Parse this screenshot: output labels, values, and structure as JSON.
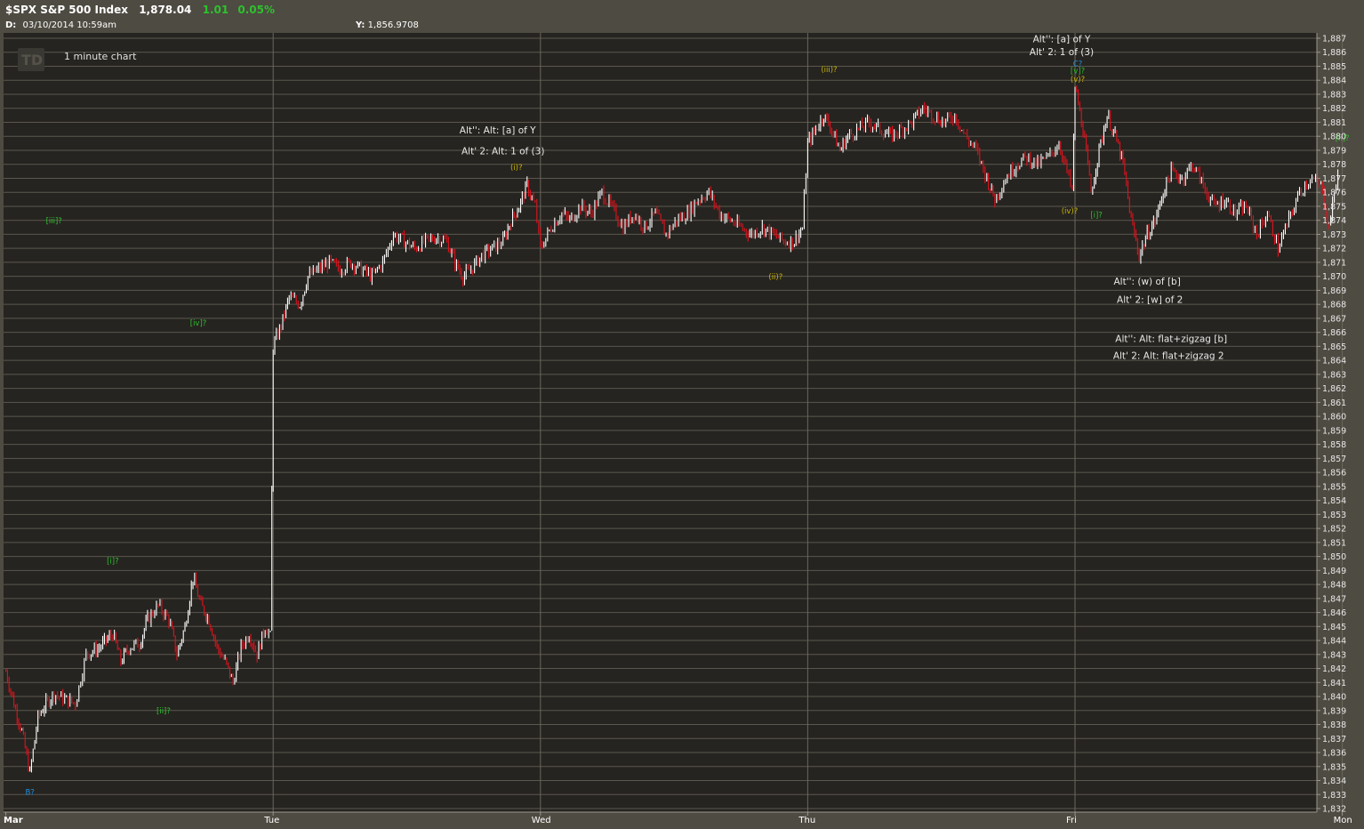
{
  "header": {
    "symbol": "$SPX S&P 500 Index",
    "last": "1,878.04",
    "change": "1.01",
    "change_pct": "0.05%",
    "date_label": "D:",
    "date_value": "03/10/2014  10:59am",
    "y_label": "Y:",
    "y_value": "1,856.9708"
  },
  "watermark": {
    "logo": "TD",
    "chart_label": "1 minute chart"
  },
  "colors": {
    "background": "#4e4b42",
    "plot_bg": "#262420",
    "grid": "#5a574e",
    "up_bar": "#ffffff",
    "down_bar": "#e0121d",
    "green_label": "#2ec12e",
    "yellow_label": "#c8b400",
    "blue_label": "#1f8fe0",
    "text": "#e8e8e8"
  },
  "chart_data": {
    "type": "line",
    "title": "$SPX S&P 500 Index",
    "ylim": [
      1832,
      1887
    ],
    "y_ticks": [
      "1,832",
      "1,833",
      "1,834",
      "1,835",
      "1,836",
      "1,837",
      "1,838",
      "1,839",
      "1,840",
      "1,841",
      "1,842",
      "1,843",
      "1,844",
      "1,845",
      "1,846",
      "1,847",
      "1,848",
      "1,849",
      "1,850",
      "1,851",
      "1,852",
      "1,853",
      "1,854",
      "1,855",
      "1,856",
      "1,857",
      "1,858",
      "1,859",
      "1,860",
      "1,861",
      "1,862",
      "1,863",
      "1,864",
      "1,865",
      "1,866",
      "1,867",
      "1,868",
      "1,869",
      "1,870",
      "1,871",
      "1,872",
      "1,873",
      "1,874",
      "1,875",
      "1,876",
      "1,877",
      "1,878",
      "1,879",
      "1,880",
      "1,881",
      "1,882",
      "1,883",
      "1,884",
      "1,885",
      "1,886",
      "1,887"
    ],
    "x_ticks": [
      {
        "label": "Mar",
        "day": 0
      },
      {
        "label": "Tue",
        "day": 1
      },
      {
        "label": "Wed",
        "day": 2
      },
      {
        "label": "Thu",
        "day": 3
      },
      {
        "label": "Fri",
        "day": 4
      },
      {
        "label": "Mon",
        "day": 5
      }
    ],
    "series": [
      {
        "points": [
          [
            0.0,
            1841.8
          ],
          [
            0.03,
            1839.5
          ],
          [
            0.06,
            1837.5
          ],
          [
            0.09,
            1834.5
          ],
          [
            0.12,
            1838.5
          ],
          [
            0.15,
            1839.5
          ],
          [
            0.18,
            1840.2
          ],
          [
            0.22,
            1839.8
          ],
          [
            0.26,
            1839.5
          ],
          [
            0.3,
            1843.0
          ],
          [
            0.35,
            1843.5
          ],
          [
            0.4,
            1844.5
          ],
          [
            0.43,
            1842.5
          ],
          [
            0.46,
            1843.5
          ],
          [
            0.5,
            1843.8
          ],
          [
            0.53,
            1845.5
          ],
          [
            0.57,
            1846.5
          ],
          [
            0.61,
            1845.5
          ],
          [
            0.64,
            1843.0
          ],
          [
            0.67,
            1845.0
          ],
          [
            0.7,
            1848.5
          ],
          [
            0.73,
            1846.5
          ],
          [
            0.76,
            1845.5
          ],
          [
            0.79,
            1843.5
          ],
          [
            0.82,
            1842.5
          ],
          [
            0.85,
            1841.0
          ],
          [
            0.88,
            1843.5
          ],
          [
            0.91,
            1844.5
          ],
          [
            0.94,
            1843.0
          ],
          [
            0.97,
            1845.0
          ],
          [
            0.99,
            1844.3
          ],
          [
            1.0,
            1865.0
          ],
          [
            1.03,
            1866.5
          ],
          [
            1.06,
            1868.5
          ],
          [
            1.1,
            1868.0
          ],
          [
            1.13,
            1870.0
          ],
          [
            1.17,
            1870.5
          ],
          [
            1.21,
            1871.0
          ],
          [
            1.25,
            1870.5
          ],
          [
            1.29,
            1871.0
          ],
          [
            1.33,
            1870.5
          ],
          [
            1.37,
            1870.0
          ],
          [
            1.41,
            1871.0
          ],
          [
            1.45,
            1873.0
          ],
          [
            1.49,
            1872.5
          ],
          [
            1.53,
            1872.0
          ],
          [
            1.57,
            1872.5
          ],
          [
            1.61,
            1872.8
          ],
          [
            1.65,
            1872.5
          ],
          [
            1.68,
            1871.0
          ],
          [
            1.71,
            1870.0
          ],
          [
            1.74,
            1870.5
          ],
          [
            1.78,
            1871.5
          ],
          [
            1.82,
            1872.0
          ],
          [
            1.86,
            1872.5
          ],
          [
            1.89,
            1874.0
          ],
          [
            1.92,
            1875.0
          ],
          [
            1.95,
            1876.5
          ],
          [
            1.98,
            1875.0
          ],
          [
            2.0,
            1872.0
          ],
          [
            2.04,
            1873.5
          ],
          [
            2.08,
            1874.5
          ],
          [
            2.11,
            1874.0
          ],
          [
            2.15,
            1875.0
          ],
          [
            2.19,
            1874.5
          ],
          [
            2.23,
            1876.0
          ],
          [
            2.27,
            1874.8
          ],
          [
            2.31,
            1873.5
          ],
          [
            2.35,
            1874.5
          ],
          [
            2.39,
            1873.5
          ],
          [
            2.43,
            1874.5
          ],
          [
            2.47,
            1873.0
          ],
          [
            2.51,
            1874.0
          ],
          [
            2.55,
            1874.5
          ],
          [
            2.59,
            1875.5
          ],
          [
            2.63,
            1876.0
          ],
          [
            2.67,
            1874.5
          ],
          [
            2.71,
            1874.0
          ],
          [
            2.75,
            1873.5
          ],
          [
            2.79,
            1873.0
          ],
          [
            2.83,
            1873.5
          ],
          [
            2.87,
            1873.0
          ],
          [
            2.91,
            1872.5
          ],
          [
            2.95,
            1872.5
          ],
          [
            2.98,
            1873.5
          ],
          [
            3.0,
            1879.5
          ],
          [
            3.03,
            1880.5
          ],
          [
            3.06,
            1881.5
          ],
          [
            3.09,
            1880.5
          ],
          [
            3.12,
            1879.0
          ],
          [
            3.15,
            1880.0
          ],
          [
            3.19,
            1880.5
          ],
          [
            3.23,
            1881.0
          ],
          [
            3.27,
            1880.5
          ],
          [
            3.31,
            1880.0
          ],
          [
            3.35,
            1880.5
          ],
          [
            3.39,
            1881.0
          ],
          [
            3.43,
            1882.0
          ],
          [
            3.47,
            1881.5
          ],
          [
            3.51,
            1881.0
          ],
          [
            3.55,
            1881.5
          ],
          [
            3.59,
            1880.0
          ],
          [
            3.63,
            1879.0
          ],
          [
            3.67,
            1877.0
          ],
          [
            3.7,
            1875.5
          ],
          [
            3.74,
            1877.0
          ],
          [
            3.78,
            1878.0
          ],
          [
            3.82,
            1878.5
          ],
          [
            3.86,
            1878.0
          ],
          [
            3.9,
            1878.5
          ],
          [
            3.94,
            1879.5
          ],
          [
            3.97,
            1877.5
          ],
          [
            3.99,
            1876.0
          ],
          [
            4.0,
            1883.5
          ],
          [
            4.03,
            1880.5
          ],
          [
            4.06,
            1876.0
          ],
          [
            4.09,
            1879.0
          ],
          [
            4.12,
            1881.5
          ],
          [
            4.15,
            1880.0
          ],
          [
            4.18,
            1878.0
          ],
          [
            4.21,
            1874.0
          ],
          [
            4.24,
            1871.5
          ],
          [
            4.27,
            1873.0
          ],
          [
            4.3,
            1874.0
          ],
          [
            4.33,
            1876.0
          ],
          [
            4.36,
            1877.5
          ],
          [
            4.4,
            1877.0
          ],
          [
            4.44,
            1878.0
          ],
          [
            4.48,
            1876.5
          ],
          [
            4.52,
            1875.0
          ],
          [
            4.56,
            1875.5
          ],
          [
            4.6,
            1874.5
          ],
          [
            4.64,
            1875.0
          ],
          [
            4.68,
            1873.0
          ],
          [
            4.72,
            1874.5
          ],
          [
            4.76,
            1872.0
          ],
          [
            4.8,
            1874.0
          ],
          [
            4.84,
            1876.0
          ],
          [
            4.88,
            1877.0
          ],
          [
            4.92,
            1876.5
          ],
          [
            4.95,
            1873.5
          ],
          [
            4.97,
            1876.0
          ],
          [
            4.99,
            1878.0
          ]
        ]
      }
    ],
    "annotations": [
      {
        "text": "B?",
        "day": 0.09,
        "y": 1833.0,
        "color": "blue"
      },
      {
        "text": "[i]?",
        "day": 0.4,
        "y": 1849.5,
        "color": "green"
      },
      {
        "text": "[ii]?",
        "day": 0.59,
        "y": 1838.8,
        "color": "green"
      },
      {
        "text": "[iii]?",
        "day": 0.18,
        "y": 1873.8,
        "color": "green"
      },
      {
        "text": "[iv]?",
        "day": 0.72,
        "y": 1866.5,
        "color": "green"
      },
      {
        "text": "(i)?",
        "day": 1.91,
        "y": 1877.6,
        "color": "yellow"
      },
      {
        "text": "Alt'': Alt: [a] of Y",
        "day": 1.84,
        "y": 1880.2,
        "color": "white"
      },
      {
        "text": "Alt' 2: Alt: 1 of (3)",
        "day": 1.86,
        "y": 1878.7,
        "color": "white"
      },
      {
        "text": "(ii)?",
        "day": 2.88,
        "y": 1869.8,
        "color": "yellow"
      },
      {
        "text": "(iii)?",
        "day": 3.08,
        "y": 1884.6,
        "color": "yellow"
      },
      {
        "text": "Alt'': [a] of Y",
        "day": 3.95,
        "y": 1886.7,
        "color": "white"
      },
      {
        "text": "Alt' 2: 1 of (3)",
        "day": 3.95,
        "y": 1885.8,
        "color": "white"
      },
      {
        "text": "C?",
        "day": 4.01,
        "y": 1885.0,
        "color": "blue"
      },
      {
        "text": "[v]?",
        "day": 4.01,
        "y": 1884.5,
        "color": "green"
      },
      {
        "text": "(v)?",
        "day": 4.01,
        "y": 1883.9,
        "color": "yellow"
      },
      {
        "text": "(iv)?",
        "day": 3.98,
        "y": 1874.5,
        "color": "yellow"
      },
      {
        "text": "[i]?",
        "day": 4.08,
        "y": 1874.2,
        "color": "green"
      },
      {
        "text": "Alt'': (w) of [b]",
        "day": 4.27,
        "y": 1869.4,
        "color": "white"
      },
      {
        "text": "Alt' 2: [w] of 2",
        "day": 4.28,
        "y": 1868.1,
        "color": "white"
      },
      {
        "text": "Alt'': Alt: flat+zigzag [b]",
        "day": 4.36,
        "y": 1865.3,
        "color": "white"
      },
      {
        "text": "Alt' 2: Alt: flat+zigzag 2",
        "day": 4.35,
        "y": 1864.1,
        "color": "white"
      },
      {
        "text": "[ii]?",
        "day": 5.0,
        "y": 1879.7,
        "color": "green"
      }
    ],
    "grid": true,
    "xlabel": "",
    "ylabel": ""
  }
}
